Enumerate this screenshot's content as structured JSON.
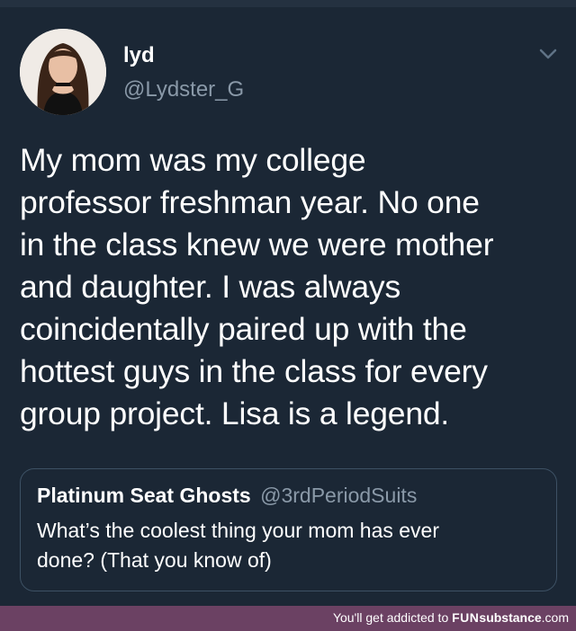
{
  "tweet": {
    "display_name": "lyd",
    "handle": "@Lydster_G",
    "text_lines": [
      "My mom was my college",
      "professor freshman year. No one",
      "in the class knew we were mother",
      "and daughter. I was always",
      "coincidentally paired up with the",
      "hottest guys in the class for every",
      "group project. Lisa is a legend."
    ],
    "menu_icon": "chevron-down-icon"
  },
  "quote": {
    "display_name": "Platinum Seat Ghosts",
    "handle": "@3rdPeriodSuits",
    "text_lines": [
      "What’s the coolest thing your mom has ever",
      "done? (That you know of)"
    ]
  },
  "footer": {
    "prefix": "You'll get addicted to",
    "brand_part1": "FUN",
    "brand_part2": "substance",
    "brand_suffix": ".com"
  },
  "colors": {
    "background": "#1b2735",
    "secondary_text": "#8a99a8",
    "card_border": "#3d5164",
    "footer_bar": "#6b4163"
  }
}
